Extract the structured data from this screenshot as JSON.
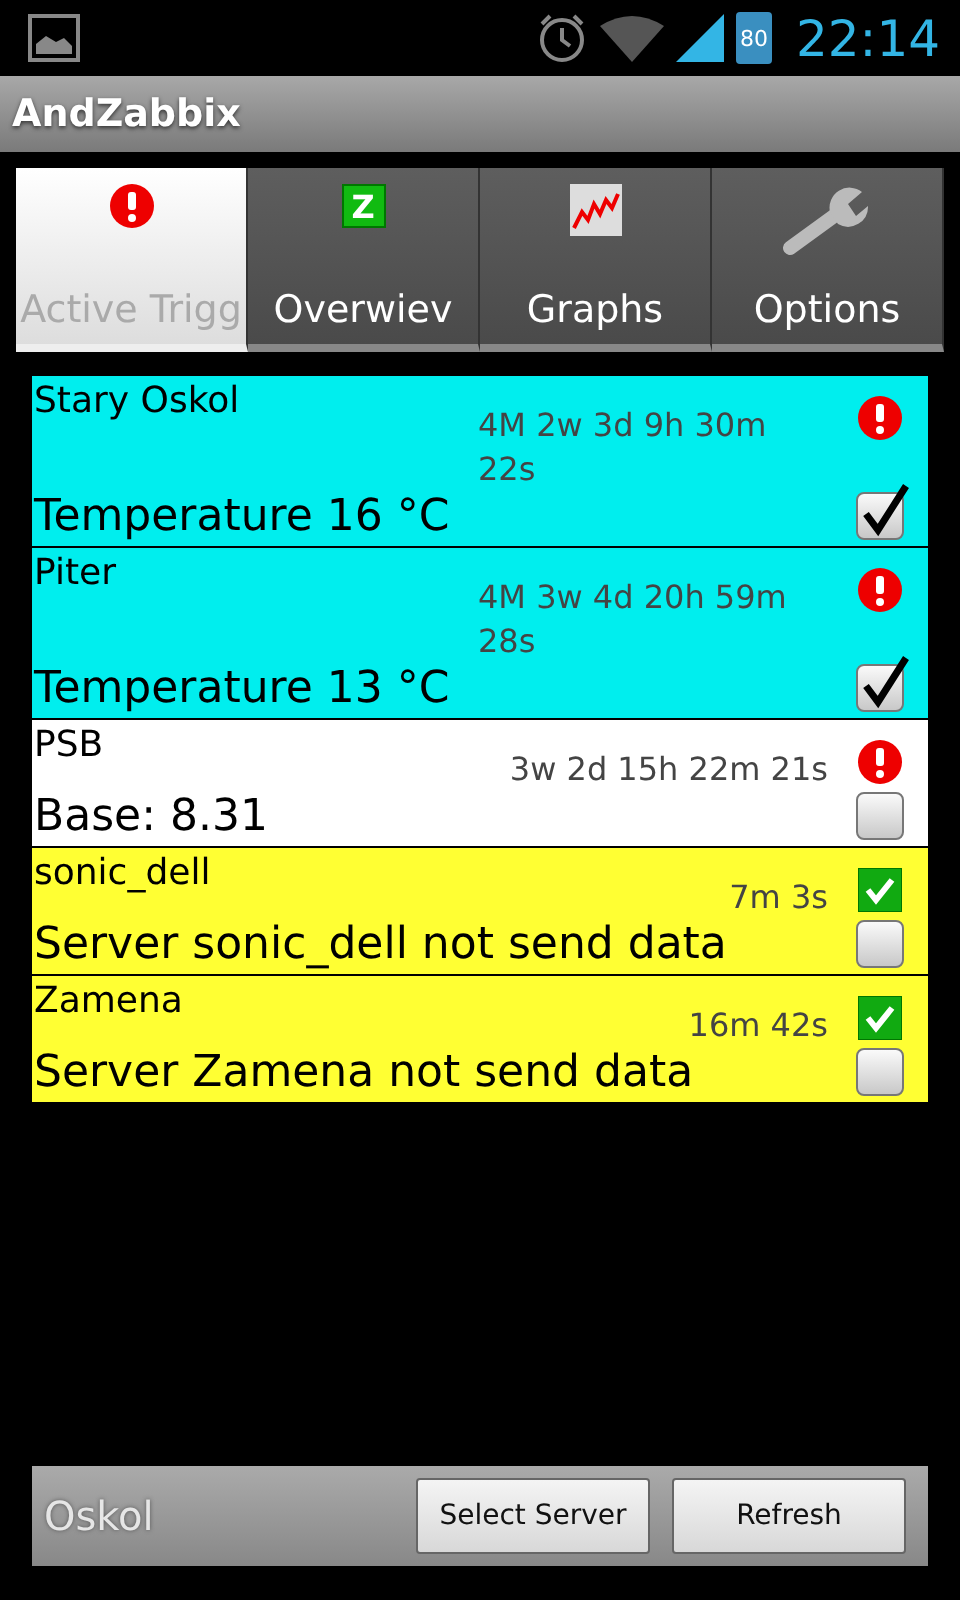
{
  "status_bar": {
    "battery": "80",
    "time": "22:14"
  },
  "app_title": "AndZabbix",
  "tabs": [
    {
      "label": "Active Trigg",
      "kind": "alert",
      "selected": true
    },
    {
      "label": "Overwiev",
      "kind": "badge",
      "badge": "Z",
      "selected": false
    },
    {
      "label": "Graphs",
      "kind": "graph",
      "selected": false
    },
    {
      "label": "Options",
      "kind": "wrench",
      "selected": false
    }
  ],
  "triggers": [
    {
      "host": "Stary Oskol",
      "age": "4M 2w 3d 9h 30m 22s",
      "description": "Temperature 16 °C",
      "kind": "problem",
      "checked": true,
      "color": "#00eeee"
    },
    {
      "host": "Piter",
      "age": "4M 3w 4d 20h 59m 28s",
      "description": "Temperature 13 °C",
      "kind": "problem",
      "checked": true,
      "color": "#00eeee"
    },
    {
      "host": "PSB",
      "age": "3w 2d 15h 22m 21s",
      "description": "Base: 8.31",
      "kind": "problem",
      "checked": false,
      "color": "#ffffff"
    },
    {
      "host": "sonic_dell",
      "age": "7m 3s",
      "description": "Server sonic_dell not send data",
      "kind": "ok",
      "checked": false,
      "color": "#ffff33"
    },
    {
      "host": "Zamena",
      "age": "16m 42s",
      "description": "Server Zamena not send data",
      "kind": "ok",
      "checked": false,
      "color": "#ffff33"
    }
  ],
  "bottom_bar": {
    "server": "Oskol",
    "buttons": [
      "Select Server",
      "Refresh"
    ]
  }
}
